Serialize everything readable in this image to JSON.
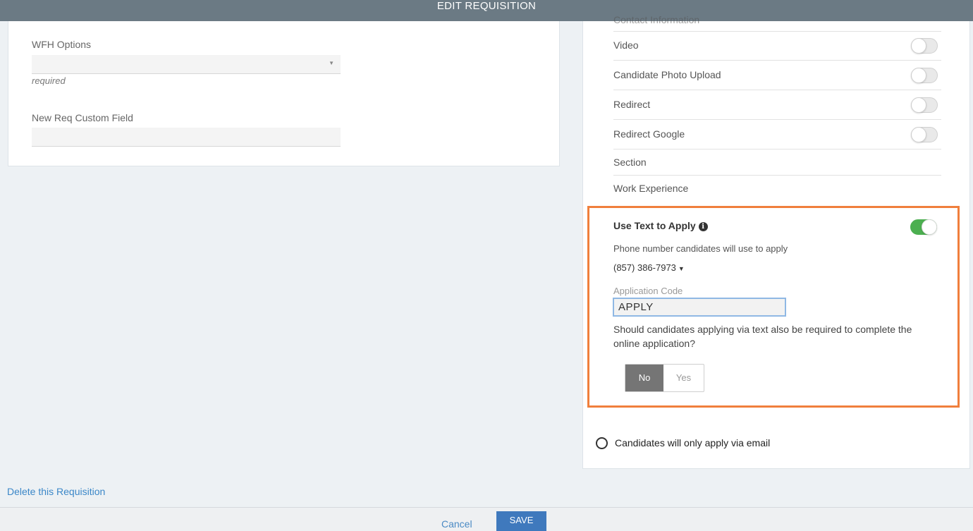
{
  "header": {
    "title": "EDIT REQUISITION"
  },
  "left_form": {
    "wfh": {
      "label": "WFH Options",
      "value": "",
      "hint": "required"
    },
    "custom_field": {
      "label": "New Req Custom Field",
      "value": ""
    }
  },
  "right_panel": {
    "cut_off_label": "Contact Information",
    "rows": [
      {
        "label": "Video",
        "toggle": false
      },
      {
        "label": "Candidate Photo Upload",
        "toggle": false
      },
      {
        "label": "Redirect",
        "toggle": false
      },
      {
        "label": "Redirect Google",
        "toggle": false
      },
      {
        "label": "Section"
      },
      {
        "label": "Work Experience"
      }
    ],
    "text_to_apply": {
      "title": "Use Text to Apply",
      "info_icon": "info-circle-icon",
      "enabled": true,
      "phone_caption": "Phone number candidates will use to apply",
      "phone_number": "(857) 386-7973",
      "app_code_label": "Application Code",
      "app_code_value": "APPLY",
      "question": "Should candidates applying via text also be required to complete the online application?",
      "options": {
        "no": "No",
        "yes": "Yes",
        "selected": "No"
      },
      "highlight_color": "#f07f3c"
    },
    "email_option": {
      "label": "Candidates will only apply via email",
      "checked": false
    }
  },
  "footer": {
    "delete_link": "Delete this Requisition",
    "cancel_label": "Cancel",
    "save_label": "SAVE"
  },
  "colors": {
    "header_bg": "#6b7a84",
    "toggle_on": "#4caf50",
    "link": "#3b87c8",
    "save_bg": "#3f79bd"
  }
}
